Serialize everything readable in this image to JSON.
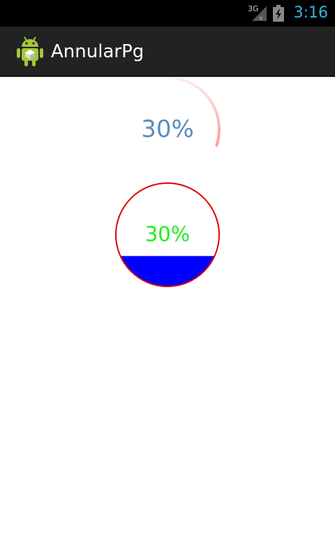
{
  "status_bar": {
    "network_type": "3G",
    "time": "3:16",
    "icons": [
      "signal-3g-icon",
      "battery-charging-icon"
    ]
  },
  "action_bar": {
    "app_icon": "android-robot-icon",
    "title": "AnnularPg"
  },
  "ring_progress": {
    "label": "30%",
    "progress": 0.3,
    "arc_color": "#ff9a9a",
    "text_color": "#5b8db8"
  },
  "water_progress": {
    "label": "30%",
    "progress": 0.3,
    "border_color": "#dd0000",
    "fill_color": "#0000ff",
    "text_color": "#22ee22"
  }
}
